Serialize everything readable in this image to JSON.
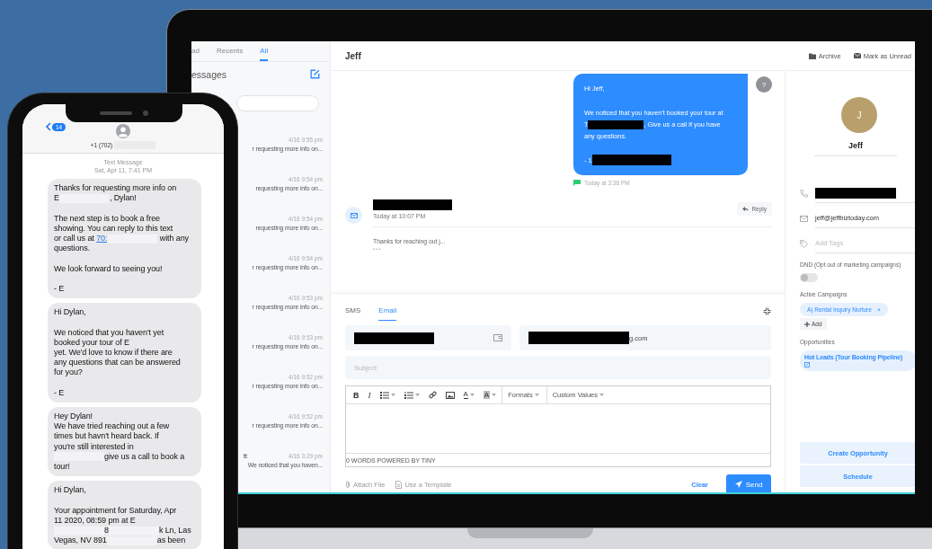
{
  "phone": {
    "back_badge": "14",
    "contact_number": "+1 (702)",
    "thread_label": "Text Message",
    "thread_time": "Sat, Apr 11, 7:41 PM",
    "messages": [
      {
        "paragraphs": [
          [
            [
              "Thanks for requesting more info on"
            ],
            [
              "E",
              {
                "kind": "redaction"
              },
              ", Dylan!"
            ]
          ],
          [
            [
              "The next step is to book a free"
            ],
            [
              "showing. You can reply to this text"
            ],
            [
              "or call us at ",
              {
                "kind": "link",
                "text": "70:"
              },
              {
                "kind": "redaction"
              },
              " with any"
            ],
            [
              "questions."
            ]
          ],
          [
            [
              "We look forward to seeing you!"
            ]
          ],
          [
            [
              "- E"
            ]
          ]
        ]
      },
      {
        "paragraphs": [
          [
            [
              "Hi Dylan,"
            ]
          ],
          [
            [
              "We noticed that you haven't yet"
            ],
            [
              "booked your tour of E"
            ],
            [
              "yet. We'd love to know if there are"
            ],
            [
              "any questions that can be answered"
            ],
            [
              "for you?"
            ]
          ],
          [
            [
              "- E"
            ]
          ]
        ]
      },
      {
        "paragraphs": [
          [
            [
              "Hey Dylan!"
            ],
            [
              "We have tried reaching out a few"
            ],
            [
              "times but havn't heard back. If"
            ],
            [
              "you're still interested in"
            ],
            [
              {
                "kind": "redaction"
              },
              "give us a call to book a"
            ],
            [
              "tour!"
            ]
          ]
        ]
      },
      {
        "paragraphs": [
          [
            [
              "Hi Dylan,"
            ]
          ],
          [
            [
              "Your appointment for Saturday, Apr"
            ],
            [
              "11 2020, 08:59 pm at E"
            ],
            [
              {
                "kind": "redaction"
              },
              "8",
              {
                "kind": "redaction"
              },
              "k Ln, Las"
            ],
            [
              "Vegas, NV 891",
              {
                "kind": "redaction"
              },
              "as been"
            ]
          ]
        ]
      }
    ]
  },
  "laptop": {
    "list_tabs": [
      {
        "label": "ad",
        "selected": false
      },
      {
        "label": "Recents",
        "selected": false
      },
      {
        "label": "All",
        "selected": true
      }
    ],
    "list_title": "essages",
    "conversations": [
      {
        "time": "4/16 9:55 pm",
        "preview": "r requesting more info on..."
      },
      {
        "time": "4/16 9:54 pm",
        "preview": "requesting more info on..."
      },
      {
        "time": "4/16 9:54 pm",
        "preview": "requesting more info on..."
      },
      {
        "time": "4/16 9:54 pm",
        "preview": "r requesting more info on..."
      },
      {
        "time": "4/16 9:53 pm",
        "preview": "r requesting more info on..."
      },
      {
        "time": "4/16 9:53 pm",
        "preview": "r requesting more info on..."
      },
      {
        "time": "4/16 9:52 pm",
        "preview": "r requesting more info on..."
      },
      {
        "time": "4/16 9:52 pm",
        "preview": "r requesting more info on..."
      },
      {
        "name": "tt",
        "time": "4/16 3:29 pm",
        "preview": "We noticed that you haven..."
      }
    ],
    "contact_title": "Jeff",
    "header_actions": [
      {
        "kind": "folder",
        "label": "Archive"
      },
      {
        "kind": "mail",
        "label": "Mark as Unread"
      }
    ],
    "outgoing": {
      "avatar": "?",
      "paragraphs": [
        [
          [
            "Hi Jeff,"
          ]
        ],
        [
          [
            "We noticed that you haven't booked your tour at"
          ],
          [
            "T",
            {
              "kind": "redaction"
            },
            ", Give us a call if you have"
          ],
          [
            "any questions."
          ]
        ],
        [
          [
            "- 1",
            {
              "kind": "redaction"
            }
          ]
        ]
      ],
      "time": "Today at 3:38 PM"
    },
    "email": {
      "sender": [
        {
          "kind": "redaction"
        }
      ],
      "time": "Today at 10:07 PM",
      "reply": "Reply",
      "snippet": "Thanks for reaching out j...",
      "more": "•••"
    },
    "compose": {
      "tabs": [
        {
          "label": "SMS",
          "selected": false
        },
        {
          "label": "Email",
          "selected": true
        }
      ],
      "from": [
        {
          "kind": "redaction"
        }
      ],
      "to": [
        {
          "kind": "redaction"
        },
        "g.com"
      ],
      "subject_placeholder": "Subject",
      "toolbar": [
        {
          "kind": "bold",
          "label": "B"
        },
        {
          "kind": "italic",
          "label": "I"
        },
        {
          "kind": "bullets"
        },
        {
          "kind": "numbers"
        },
        {
          "kind": "link"
        },
        {
          "kind": "image"
        },
        {
          "kind": "text-color",
          "label": "A"
        },
        {
          "kind": "highlight",
          "label": "A"
        }
      ],
      "menus": [
        "Formats",
        "Custom Values"
      ],
      "status": "0 WORDS POWERED BY TINY",
      "attach": "Attach File",
      "template": "Use a Template",
      "clear": "Clear",
      "send": "Send"
    },
    "contact": {
      "initial": "J",
      "name": "Jeff",
      "phone": [
        {
          "kind": "redaction"
        }
      ],
      "email": "jeff@jeffbiztoday.com",
      "tags_placeholder": "Add Tags",
      "dnd_label": "DND (Opt out of marketing campaigns)",
      "dnd_on": false,
      "campaigns_label": "Active Campaigns",
      "campaigns": [
        {
          "label": "A) Rental Inquiry Nurture",
          "remove": "×"
        }
      ],
      "add": "Add",
      "opportunities_label": "Opportunities",
      "opportunities": [
        "Hot Leads (Tour Booking Pipeline)"
      ],
      "buttons": [
        "Create Opportunity",
        "Schedule"
      ]
    }
  }
}
